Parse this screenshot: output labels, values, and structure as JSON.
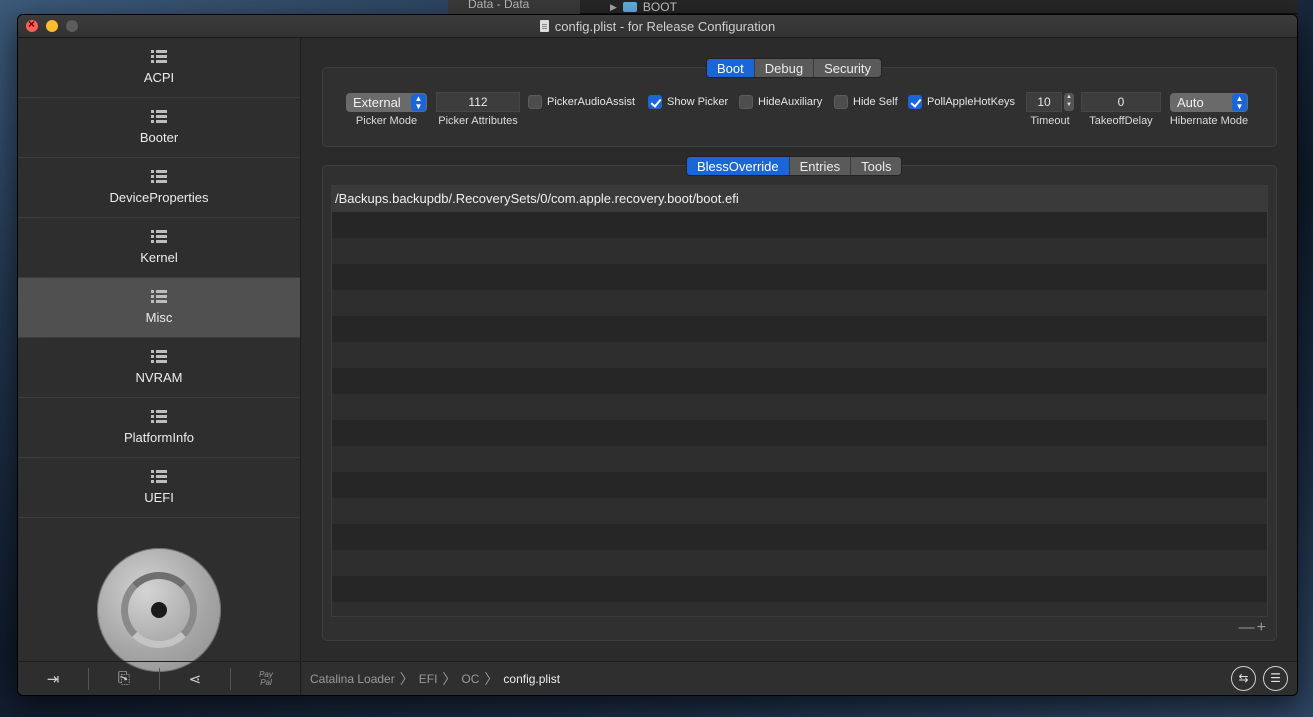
{
  "background": {
    "finder_item_left": "Data - Data",
    "finder_item_right": "BOOT"
  },
  "window": {
    "title": "config.plist - for Release Configuration"
  },
  "sidebar": {
    "items": [
      {
        "label": "ACPI"
      },
      {
        "label": "Booter"
      },
      {
        "label": "DeviceProperties"
      },
      {
        "label": "Kernel"
      },
      {
        "label": "Misc",
        "active": true
      },
      {
        "label": "NVRAM"
      },
      {
        "label": "PlatformInfo"
      },
      {
        "label": "UEFI"
      }
    ],
    "bottom_buttons": [
      "import-icon",
      "export-icon",
      "share-icon",
      "paypal-icon"
    ],
    "paypal_label_1": "Pay",
    "paypal_label_2": "Pal"
  },
  "top_tabs": {
    "items": [
      "Boot",
      "Debug",
      "Security"
    ],
    "selected": "Boot"
  },
  "boot": {
    "picker_mode": {
      "value": "External",
      "label": "Picker Mode"
    },
    "picker_attributes": {
      "value": "112",
      "label": "Picker Attributes"
    },
    "checkboxes": [
      {
        "label": "PickerAudioAssist",
        "checked": false
      },
      {
        "label": "Show Picker",
        "checked": true
      },
      {
        "label": "HideAuxiliary",
        "checked": false
      },
      {
        "label": "Hide Self",
        "checked": false
      },
      {
        "label": "PollAppleHotKeys",
        "checked": true
      }
    ],
    "timeout": {
      "value": "10",
      "label": "Timeout"
    },
    "takeoff_delay": {
      "value": "0",
      "label": "TakeoffDelay"
    },
    "hibernate_mode": {
      "value": "Auto",
      "label": "Hibernate Mode"
    }
  },
  "sub_tabs": {
    "items": [
      "BlessOverride",
      "Entries",
      "Tools"
    ],
    "selected": "BlessOverride"
  },
  "bless_table": {
    "rows": [
      "/Backups.backupdb/.RecoverySets/0/com.apple.recovery.boot/boot.efi"
    ]
  },
  "table_controls": {
    "minus": "—",
    "plus": "+"
  },
  "breadcrumb": {
    "items": [
      "Catalina Loader",
      "EFI",
      "OC",
      "config.plist"
    ]
  },
  "colors": {
    "accent": "#1a66d9",
    "window_bg": "#2b2b2b",
    "sidebar_active": "#505050"
  }
}
